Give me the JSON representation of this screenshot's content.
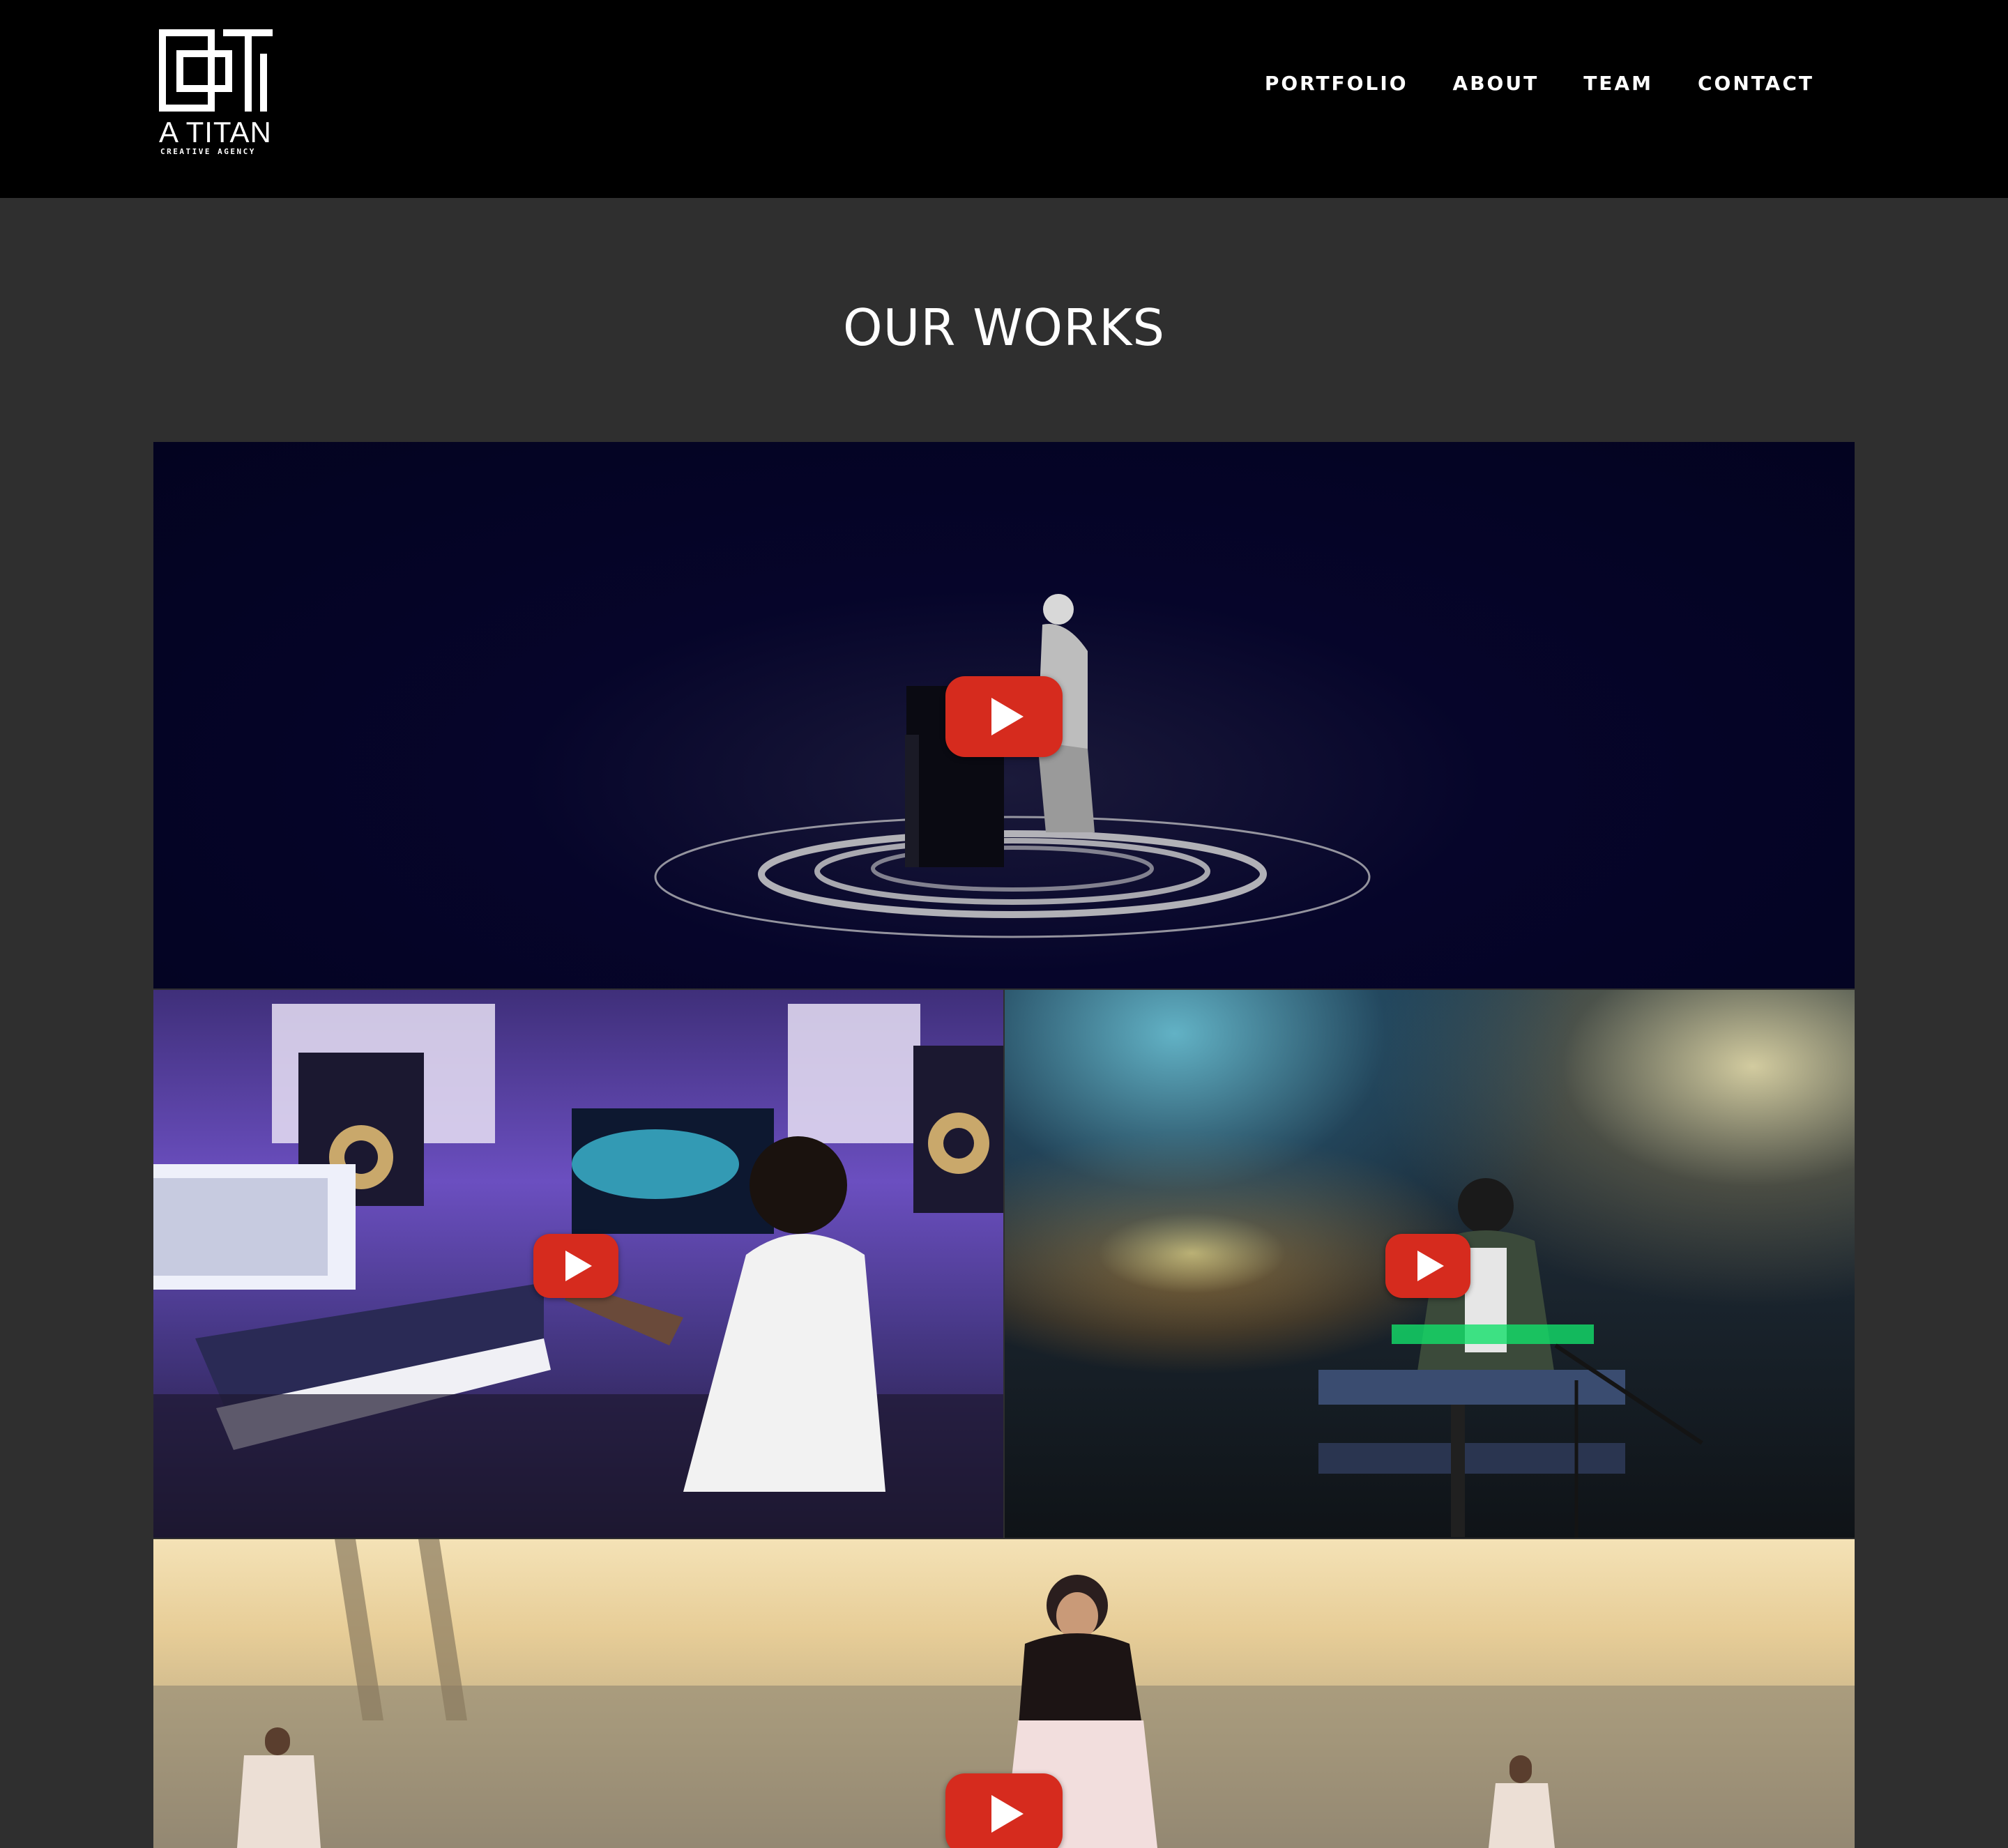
{
  "brand": {
    "name": "A TITAN",
    "tagline": "CREATIVE AGENCY"
  },
  "nav": {
    "items": [
      "PORTFOLIO",
      "ABOUT",
      "TEAM",
      "CONTACT"
    ]
  },
  "works": {
    "title": "OUR WORKS",
    "videos": [
      {
        "thumbnail": "pianist-on-dark-stage",
        "icon": "youtube-play-icon"
      },
      {
        "thumbnail": "musician-in-recording-studio",
        "icon": "youtube-play-icon"
      },
      {
        "thumbnail": "keyboardist-on-smoky-stage",
        "icon": "youtube-play-icon"
      },
      {
        "thumbnail": "girl-singing-outdoors",
        "icon": "youtube-play-icon"
      }
    ]
  },
  "colors": {
    "header_bg": "#000000",
    "page_bg": "#2f2f2f",
    "play_button": "#d62b1e",
    "text": "#ffffff"
  }
}
